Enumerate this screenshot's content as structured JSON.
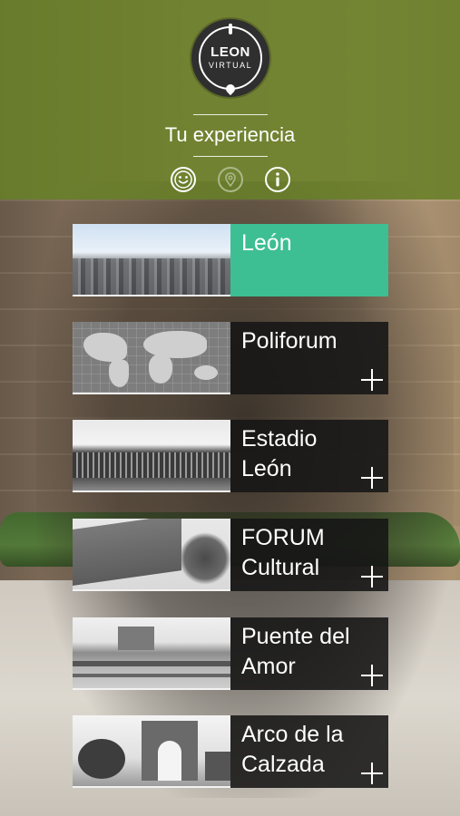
{
  "brand": {
    "logo_word_top": "LEON",
    "logo_word_bottom": "VIRTUAL"
  },
  "header": {
    "subtitle": "Tu experiencia",
    "icons": [
      {
        "name": "smiley-icon",
        "state": "active"
      },
      {
        "name": "location-pin-icon",
        "state": "inactive"
      },
      {
        "name": "info-icon",
        "state": "active"
      }
    ],
    "accent_color": "#688028"
  },
  "menu": {
    "active_color": "#3dbf93",
    "items": [
      {
        "label": "León",
        "active": true,
        "has_plus": false
      },
      {
        "label": "Poliforum",
        "active": false,
        "has_plus": true
      },
      {
        "label": "Estadio\nLeón",
        "active": false,
        "has_plus": true
      },
      {
        "label": "FORUM\nCultural",
        "active": false,
        "has_plus": true
      },
      {
        "label": "Puente del\nAmor",
        "active": false,
        "has_plus": true
      },
      {
        "label": "Arco de la\nCalzada",
        "active": false,
        "has_plus": true
      }
    ]
  }
}
